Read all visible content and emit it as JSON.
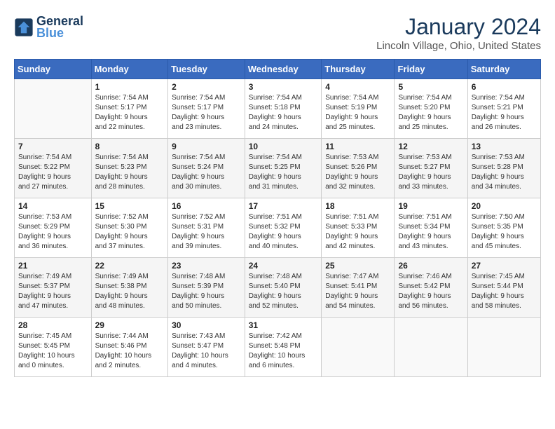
{
  "header": {
    "logo_text_1": "General",
    "logo_text_2": "Blue",
    "month": "January 2024",
    "location": "Lincoln Village, Ohio, United States"
  },
  "weekdays": [
    "Sunday",
    "Monday",
    "Tuesday",
    "Wednesday",
    "Thursday",
    "Friday",
    "Saturday"
  ],
  "weeks": [
    [
      {
        "day": "",
        "info": ""
      },
      {
        "day": "1",
        "info": "Sunrise: 7:54 AM\nSunset: 5:17 PM\nDaylight: 9 hours\nand 22 minutes."
      },
      {
        "day": "2",
        "info": "Sunrise: 7:54 AM\nSunset: 5:17 PM\nDaylight: 9 hours\nand 23 minutes."
      },
      {
        "day": "3",
        "info": "Sunrise: 7:54 AM\nSunset: 5:18 PM\nDaylight: 9 hours\nand 24 minutes."
      },
      {
        "day": "4",
        "info": "Sunrise: 7:54 AM\nSunset: 5:19 PM\nDaylight: 9 hours\nand 25 minutes."
      },
      {
        "day": "5",
        "info": "Sunrise: 7:54 AM\nSunset: 5:20 PM\nDaylight: 9 hours\nand 25 minutes."
      },
      {
        "day": "6",
        "info": "Sunrise: 7:54 AM\nSunset: 5:21 PM\nDaylight: 9 hours\nand 26 minutes."
      }
    ],
    [
      {
        "day": "7",
        "info": "Sunrise: 7:54 AM\nSunset: 5:22 PM\nDaylight: 9 hours\nand 27 minutes."
      },
      {
        "day": "8",
        "info": "Sunrise: 7:54 AM\nSunset: 5:23 PM\nDaylight: 9 hours\nand 28 minutes."
      },
      {
        "day": "9",
        "info": "Sunrise: 7:54 AM\nSunset: 5:24 PM\nDaylight: 9 hours\nand 30 minutes."
      },
      {
        "day": "10",
        "info": "Sunrise: 7:54 AM\nSunset: 5:25 PM\nDaylight: 9 hours\nand 31 minutes."
      },
      {
        "day": "11",
        "info": "Sunrise: 7:53 AM\nSunset: 5:26 PM\nDaylight: 9 hours\nand 32 minutes."
      },
      {
        "day": "12",
        "info": "Sunrise: 7:53 AM\nSunset: 5:27 PM\nDaylight: 9 hours\nand 33 minutes."
      },
      {
        "day": "13",
        "info": "Sunrise: 7:53 AM\nSunset: 5:28 PM\nDaylight: 9 hours\nand 34 minutes."
      }
    ],
    [
      {
        "day": "14",
        "info": "Sunrise: 7:53 AM\nSunset: 5:29 PM\nDaylight: 9 hours\nand 36 minutes."
      },
      {
        "day": "15",
        "info": "Sunrise: 7:52 AM\nSunset: 5:30 PM\nDaylight: 9 hours\nand 37 minutes."
      },
      {
        "day": "16",
        "info": "Sunrise: 7:52 AM\nSunset: 5:31 PM\nDaylight: 9 hours\nand 39 minutes."
      },
      {
        "day": "17",
        "info": "Sunrise: 7:51 AM\nSunset: 5:32 PM\nDaylight: 9 hours\nand 40 minutes."
      },
      {
        "day": "18",
        "info": "Sunrise: 7:51 AM\nSunset: 5:33 PM\nDaylight: 9 hours\nand 42 minutes."
      },
      {
        "day": "19",
        "info": "Sunrise: 7:51 AM\nSunset: 5:34 PM\nDaylight: 9 hours\nand 43 minutes."
      },
      {
        "day": "20",
        "info": "Sunrise: 7:50 AM\nSunset: 5:35 PM\nDaylight: 9 hours\nand 45 minutes."
      }
    ],
    [
      {
        "day": "21",
        "info": "Sunrise: 7:49 AM\nSunset: 5:37 PM\nDaylight: 9 hours\nand 47 minutes."
      },
      {
        "day": "22",
        "info": "Sunrise: 7:49 AM\nSunset: 5:38 PM\nDaylight: 9 hours\nand 48 minutes."
      },
      {
        "day": "23",
        "info": "Sunrise: 7:48 AM\nSunset: 5:39 PM\nDaylight: 9 hours\nand 50 minutes."
      },
      {
        "day": "24",
        "info": "Sunrise: 7:48 AM\nSunset: 5:40 PM\nDaylight: 9 hours\nand 52 minutes."
      },
      {
        "day": "25",
        "info": "Sunrise: 7:47 AM\nSunset: 5:41 PM\nDaylight: 9 hours\nand 54 minutes."
      },
      {
        "day": "26",
        "info": "Sunrise: 7:46 AM\nSunset: 5:42 PM\nDaylight: 9 hours\nand 56 minutes."
      },
      {
        "day": "27",
        "info": "Sunrise: 7:45 AM\nSunset: 5:44 PM\nDaylight: 9 hours\nand 58 minutes."
      }
    ],
    [
      {
        "day": "28",
        "info": "Sunrise: 7:45 AM\nSunset: 5:45 PM\nDaylight: 10 hours\nand 0 minutes."
      },
      {
        "day": "29",
        "info": "Sunrise: 7:44 AM\nSunset: 5:46 PM\nDaylight: 10 hours\nand 2 minutes."
      },
      {
        "day": "30",
        "info": "Sunrise: 7:43 AM\nSunset: 5:47 PM\nDaylight: 10 hours\nand 4 minutes."
      },
      {
        "day": "31",
        "info": "Sunrise: 7:42 AM\nSunset: 5:48 PM\nDaylight: 10 hours\nand 6 minutes."
      },
      {
        "day": "",
        "info": ""
      },
      {
        "day": "",
        "info": ""
      },
      {
        "day": "",
        "info": ""
      }
    ]
  ]
}
